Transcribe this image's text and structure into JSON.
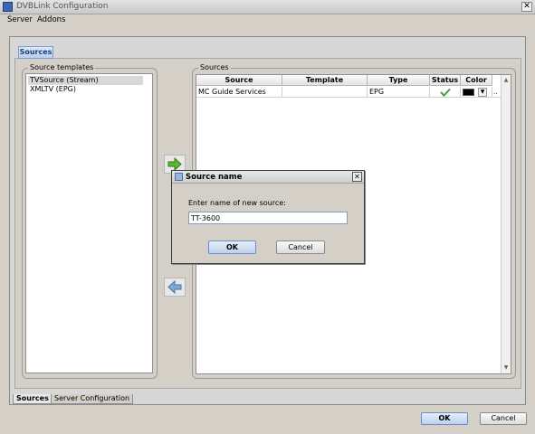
{
  "window": {
    "title": "DVBLink Configuration",
    "close_glyph": "✕"
  },
  "menu": {
    "items": [
      "Server",
      "Addons"
    ]
  },
  "inner_tab": {
    "label": "Sources"
  },
  "templates": {
    "legend": "Source templates",
    "items": [
      "TVSource (Stream)",
      "XMLTV (EPG)"
    ],
    "selected_index": 0
  },
  "sources": {
    "legend": "Sources",
    "columns": [
      "Source",
      "Template",
      "Type",
      "Status",
      "Color"
    ],
    "rows": [
      {
        "source": "MC Guide Services",
        "template": "",
        "type": "EPG",
        "status_icon": "check-icon",
        "color": "#000000",
        "more_label": ".."
      }
    ]
  },
  "bottom_tabs": [
    {
      "label": "Sources",
      "active": true
    },
    {
      "label": "Server Configuration",
      "active": false
    }
  ],
  "footer": {
    "ok_label": "OK",
    "cancel_label": "Cancel"
  },
  "dialog": {
    "title": "Source name",
    "prompt": "Enter name of new source:",
    "input_value": "TT-3600",
    "ok_label": "OK",
    "cancel_label": "Cancel"
  },
  "colors": {
    "accent": "#3b66b6",
    "add_arrow": "#5cb832",
    "remove_arrow": "#7fa7d8",
    "check": "#3fa33a"
  }
}
